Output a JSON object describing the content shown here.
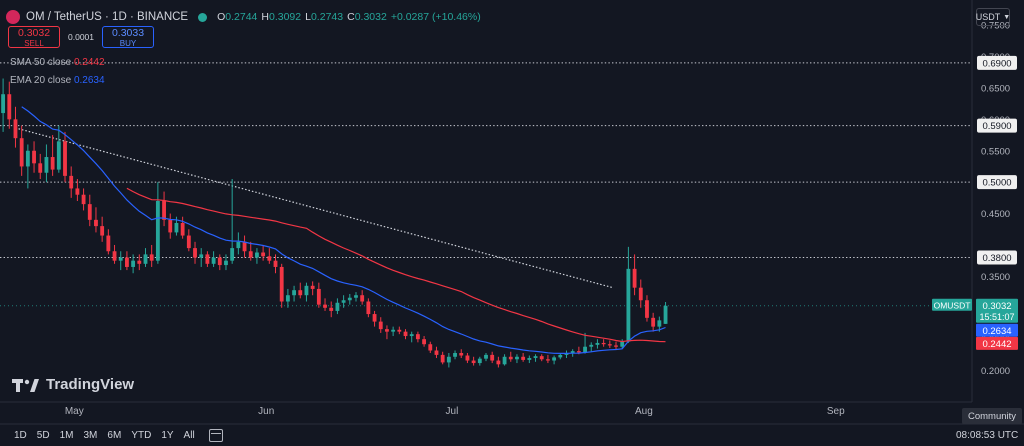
{
  "header": {
    "symbol": "OM / TetherUS · 1D · BINANCE",
    "ohlc": [
      {
        "k": "O",
        "v": "0.2744"
      },
      {
        "k": "H",
        "v": "0.3092"
      },
      {
        "k": "L",
        "v": "0.2743"
      },
      {
        "k": "C",
        "v": "0.3032"
      }
    ],
    "change": "+0.0287 (+10.46%)"
  },
  "trade": {
    "sell_price": "0.3032",
    "sell_label": "SELL",
    "spread": "0.0001",
    "buy_price": "0.3033",
    "buy_label": "BUY"
  },
  "indicators": {
    "sma_label": "SMA 50 close",
    "sma_value": "0.2442",
    "ema_label": "EMA 20 close",
    "ema_value": "0.2634"
  },
  "currency_button": "USDT",
  "branding": "TradingView",
  "timeframes": [
    "1D",
    "5D",
    "1M",
    "3M",
    "6M",
    "YTD",
    "1Y",
    "All"
  ],
  "time_display": "08:08:53 UTC",
  "community_label": "Community",
  "colors": {
    "background": "#131722",
    "up": "#26a69a",
    "down": "#f23645",
    "sma": "#f23645",
    "ema": "#2962ff",
    "text": "#d1d4dc"
  },
  "chart_data": {
    "type": "candlestick",
    "y_axis": {
      "range": [
        0.15,
        0.79
      ],
      "ticks": [
        "0.2000",
        "0.2500",
        "0.3500",
        "0.4500",
        "0.5500",
        "0.6000",
        "0.6500",
        "0.7000",
        "0.7500"
      ]
    },
    "x_axis": {
      "range": [
        "2024-04-19",
        "2024-09-23"
      ],
      "ticks": [
        {
          "label": "May",
          "date": "2024-05-01"
        },
        {
          "label": "Jun",
          "date": "2024-06-01"
        },
        {
          "label": "Jul",
          "date": "2024-07-01"
        },
        {
          "label": "Aug",
          "date": "2024-08-01"
        },
        {
          "label": "Sep",
          "date": "2024-09-01"
        }
      ]
    },
    "grid": false,
    "horizontal_levels": [
      "0.6900",
      "0.5900",
      "0.5000",
      "0.3800"
    ],
    "trendline": {
      "from": [
        "2024-04-22",
        0.585
      ],
      "to": [
        "2024-07-27",
        0.332
      ]
    },
    "last_price": {
      "symbol": "OMUSDT",
      "price": "0.3032",
      "countdown": "15:51:07"
    },
    "candles": [
      {
        "d": "2024-04-19",
        "o": 0.61,
        "h": 0.665,
        "l": 0.58,
        "c": 0.64
      },
      {
        "d": "2024-04-20",
        "o": 0.64,
        "h": 0.66,
        "l": 0.585,
        "c": 0.6
      },
      {
        "d": "2024-04-21",
        "o": 0.6,
        "h": 0.62,
        "l": 0.555,
        "c": 0.57
      },
      {
        "d": "2024-04-22",
        "o": 0.57,
        "h": 0.59,
        "l": 0.51,
        "c": 0.525
      },
      {
        "d": "2024-04-23",
        "o": 0.525,
        "h": 0.56,
        "l": 0.49,
        "c": 0.55
      },
      {
        "d": "2024-04-24",
        "o": 0.55,
        "h": 0.565,
        "l": 0.515,
        "c": 0.53
      },
      {
        "d": "2024-04-25",
        "o": 0.53,
        "h": 0.545,
        "l": 0.505,
        "c": 0.515
      },
      {
        "d": "2024-04-26",
        "o": 0.515,
        "h": 0.56,
        "l": 0.5,
        "c": 0.54
      },
      {
        "d": "2024-04-27",
        "o": 0.54,
        "h": 0.575,
        "l": 0.51,
        "c": 0.52
      },
      {
        "d": "2024-04-28",
        "o": 0.52,
        "h": 0.59,
        "l": 0.515,
        "c": 0.565
      },
      {
        "d": "2024-04-29",
        "o": 0.565,
        "h": 0.58,
        "l": 0.5,
        "c": 0.51
      },
      {
        "d": "2024-04-30",
        "o": 0.51,
        "h": 0.525,
        "l": 0.475,
        "c": 0.49
      },
      {
        "d": "2024-05-01",
        "o": 0.49,
        "h": 0.505,
        "l": 0.47,
        "c": 0.48
      },
      {
        "d": "2024-05-02",
        "o": 0.48,
        "h": 0.49,
        "l": 0.455,
        "c": 0.465
      },
      {
        "d": "2024-05-03",
        "o": 0.465,
        "h": 0.48,
        "l": 0.43,
        "c": 0.44
      },
      {
        "d": "2024-05-04",
        "o": 0.44,
        "h": 0.46,
        "l": 0.42,
        "c": 0.43
      },
      {
        "d": "2024-05-05",
        "o": 0.43,
        "h": 0.445,
        "l": 0.405,
        "c": 0.415
      },
      {
        "d": "2024-05-06",
        "o": 0.415,
        "h": 0.425,
        "l": 0.385,
        "c": 0.39
      },
      {
        "d": "2024-05-07",
        "o": 0.39,
        "h": 0.4,
        "l": 0.37,
        "c": 0.375
      },
      {
        "d": "2024-05-08",
        "o": 0.375,
        "h": 0.39,
        "l": 0.36,
        "c": 0.38
      },
      {
        "d": "2024-05-09",
        "o": 0.38,
        "h": 0.39,
        "l": 0.36,
        "c": 0.365
      },
      {
        "d": "2024-05-10",
        "o": 0.365,
        "h": 0.385,
        "l": 0.355,
        "c": 0.375
      },
      {
        "d": "2024-05-11",
        "o": 0.375,
        "h": 0.385,
        "l": 0.36,
        "c": 0.37
      },
      {
        "d": "2024-05-12",
        "o": 0.37,
        "h": 0.395,
        "l": 0.365,
        "c": 0.385
      },
      {
        "d": "2024-05-13",
        "o": 0.385,
        "h": 0.4,
        "l": 0.365,
        "c": 0.375
      },
      {
        "d": "2024-05-14",
        "o": 0.375,
        "h": 0.5,
        "l": 0.37,
        "c": 0.47
      },
      {
        "d": "2024-05-15",
        "o": 0.47,
        "h": 0.485,
        "l": 0.43,
        "c": 0.44
      },
      {
        "d": "2024-05-16",
        "o": 0.44,
        "h": 0.45,
        "l": 0.41,
        "c": 0.42
      },
      {
        "d": "2024-05-17",
        "o": 0.42,
        "h": 0.445,
        "l": 0.415,
        "c": 0.435
      },
      {
        "d": "2024-05-18",
        "o": 0.435,
        "h": 0.445,
        "l": 0.41,
        "c": 0.415
      },
      {
        "d": "2024-05-19",
        "o": 0.415,
        "h": 0.425,
        "l": 0.39,
        "c": 0.395
      },
      {
        "d": "2024-05-20",
        "o": 0.395,
        "h": 0.405,
        "l": 0.37,
        "c": 0.38
      },
      {
        "d": "2024-05-21",
        "o": 0.38,
        "h": 0.395,
        "l": 0.365,
        "c": 0.385
      },
      {
        "d": "2024-05-22",
        "o": 0.385,
        "h": 0.39,
        "l": 0.365,
        "c": 0.37
      },
      {
        "d": "2024-05-23",
        "o": 0.37,
        "h": 0.39,
        "l": 0.365,
        "c": 0.38
      },
      {
        "d": "2024-05-24",
        "o": 0.38,
        "h": 0.385,
        "l": 0.36,
        "c": 0.368
      },
      {
        "d": "2024-05-25",
        "o": 0.368,
        "h": 0.385,
        "l": 0.36,
        "c": 0.375
      },
      {
        "d": "2024-05-26",
        "o": 0.375,
        "h": 0.505,
        "l": 0.37,
        "c": 0.395
      },
      {
        "d": "2024-05-27",
        "o": 0.395,
        "h": 0.42,
        "l": 0.385,
        "c": 0.405
      },
      {
        "d": "2024-05-28",
        "o": 0.405,
        "h": 0.415,
        "l": 0.38,
        "c": 0.39
      },
      {
        "d": "2024-05-29",
        "o": 0.39,
        "h": 0.405,
        "l": 0.375,
        "c": 0.38
      },
      {
        "d": "2024-05-30",
        "o": 0.38,
        "h": 0.395,
        "l": 0.37,
        "c": 0.388
      },
      {
        "d": "2024-05-31",
        "o": 0.388,
        "h": 0.4,
        "l": 0.375,
        "c": 0.382
      },
      {
        "d": "2024-06-01",
        "o": 0.382,
        "h": 0.395,
        "l": 0.37,
        "c": 0.375
      },
      {
        "d": "2024-06-02",
        "o": 0.375,
        "h": 0.385,
        "l": 0.355,
        "c": 0.365
      },
      {
        "d": "2024-06-03",
        "o": 0.365,
        "h": 0.37,
        "l": 0.3,
        "c": 0.31
      },
      {
        "d": "2024-06-04",
        "o": 0.31,
        "h": 0.33,
        "l": 0.3,
        "c": 0.32
      },
      {
        "d": "2024-06-05",
        "o": 0.32,
        "h": 0.335,
        "l": 0.31,
        "c": 0.328
      },
      {
        "d": "2024-06-06",
        "o": 0.328,
        "h": 0.34,
        "l": 0.315,
        "c": 0.32
      },
      {
        "d": "2024-06-07",
        "o": 0.32,
        "h": 0.34,
        "l": 0.31,
        "c": 0.335
      },
      {
        "d": "2024-06-08",
        "o": 0.335,
        "h": 0.342,
        "l": 0.32,
        "c": 0.33
      },
      {
        "d": "2024-06-09",
        "o": 0.33,
        "h": 0.34,
        "l": 0.3,
        "c": 0.305
      },
      {
        "d": "2024-06-10",
        "o": 0.305,
        "h": 0.315,
        "l": 0.295,
        "c": 0.3
      },
      {
        "d": "2024-06-11",
        "o": 0.3,
        "h": 0.31,
        "l": 0.285,
        "c": 0.295
      },
      {
        "d": "2024-06-12",
        "o": 0.295,
        "h": 0.315,
        "l": 0.29,
        "c": 0.308
      },
      {
        "d": "2024-06-13",
        "o": 0.308,
        "h": 0.32,
        "l": 0.3,
        "c": 0.312
      },
      {
        "d": "2024-06-14",
        "o": 0.312,
        "h": 0.322,
        "l": 0.305,
        "c": 0.316
      },
      {
        "d": "2024-06-15",
        "o": 0.316,
        "h": 0.325,
        "l": 0.31,
        "c": 0.32
      },
      {
        "d": "2024-06-16",
        "o": 0.32,
        "h": 0.328,
        "l": 0.305,
        "c": 0.31
      },
      {
        "d": "2024-06-17",
        "o": 0.31,
        "h": 0.315,
        "l": 0.285,
        "c": 0.29
      },
      {
        "d": "2024-06-18",
        "o": 0.29,
        "h": 0.295,
        "l": 0.27,
        "c": 0.278
      },
      {
        "d": "2024-06-19",
        "o": 0.278,
        "h": 0.285,
        "l": 0.26,
        "c": 0.266
      },
      {
        "d": "2024-06-20",
        "o": 0.266,
        "h": 0.272,
        "l": 0.25,
        "c": 0.262
      },
      {
        "d": "2024-06-21",
        "o": 0.262,
        "h": 0.27,
        "l": 0.255,
        "c": 0.265
      },
      {
        "d": "2024-06-22",
        "o": 0.265,
        "h": 0.27,
        "l": 0.258,
        "c": 0.262
      },
      {
        "d": "2024-06-23",
        "o": 0.262,
        "h": 0.266,
        "l": 0.25,
        "c": 0.255
      },
      {
        "d": "2024-06-24",
        "o": 0.255,
        "h": 0.262,
        "l": 0.245,
        "c": 0.258
      },
      {
        "d": "2024-06-25",
        "o": 0.258,
        "h": 0.262,
        "l": 0.245,
        "c": 0.25
      },
      {
        "d": "2024-06-26",
        "o": 0.25,
        "h": 0.255,
        "l": 0.238,
        "c": 0.242
      },
      {
        "d": "2024-06-27",
        "o": 0.242,
        "h": 0.246,
        "l": 0.228,
        "c": 0.232
      },
      {
        "d": "2024-06-28",
        "o": 0.232,
        "h": 0.238,
        "l": 0.22,
        "c": 0.225
      },
      {
        "d": "2024-06-29",
        "o": 0.225,
        "h": 0.23,
        "l": 0.21,
        "c": 0.213
      },
      {
        "d": "2024-06-30",
        "o": 0.213,
        "h": 0.228,
        "l": 0.205,
        "c": 0.222
      },
      {
        "d": "2024-07-01",
        "o": 0.222,
        "h": 0.232,
        "l": 0.218,
        "c": 0.228
      },
      {
        "d": "2024-07-02",
        "o": 0.228,
        "h": 0.234,
        "l": 0.22,
        "c": 0.224
      },
      {
        "d": "2024-07-03",
        "o": 0.224,
        "h": 0.228,
        "l": 0.212,
        "c": 0.216
      },
      {
        "d": "2024-07-04",
        "o": 0.216,
        "h": 0.222,
        "l": 0.208,
        "c": 0.212
      },
      {
        "d": "2024-07-05",
        "o": 0.212,
        "h": 0.222,
        "l": 0.208,
        "c": 0.219
      },
      {
        "d": "2024-07-06",
        "o": 0.219,
        "h": 0.228,
        "l": 0.215,
        "c": 0.225
      },
      {
        "d": "2024-07-07",
        "o": 0.225,
        "h": 0.23,
        "l": 0.212,
        "c": 0.216
      },
      {
        "d": "2024-07-08",
        "o": 0.216,
        "h": 0.222,
        "l": 0.205,
        "c": 0.21
      },
      {
        "d": "2024-07-09",
        "o": 0.21,
        "h": 0.226,
        "l": 0.208,
        "c": 0.222
      },
      {
        "d": "2024-07-10",
        "o": 0.222,
        "h": 0.23,
        "l": 0.214,
        "c": 0.218
      },
      {
        "d": "2024-07-11",
        "o": 0.218,
        "h": 0.226,
        "l": 0.212,
        "c": 0.222
      },
      {
        "d": "2024-07-12",
        "o": 0.222,
        "h": 0.228,
        "l": 0.214,
        "c": 0.217
      },
      {
        "d": "2024-07-13",
        "o": 0.217,
        "h": 0.224,
        "l": 0.212,
        "c": 0.22
      },
      {
        "d": "2024-07-14",
        "o": 0.22,
        "h": 0.226,
        "l": 0.214,
        "c": 0.223
      },
      {
        "d": "2024-07-15",
        "o": 0.223,
        "h": 0.226,
        "l": 0.215,
        "c": 0.218
      },
      {
        "d": "2024-07-16",
        "o": 0.218,
        "h": 0.225,
        "l": 0.212,
        "c": 0.216
      },
      {
        "d": "2024-07-17",
        "o": 0.216,
        "h": 0.224,
        "l": 0.21,
        "c": 0.221
      },
      {
        "d": "2024-07-18",
        "o": 0.221,
        "h": 0.228,
        "l": 0.218,
        "c": 0.225
      },
      {
        "d": "2024-07-19",
        "o": 0.225,
        "h": 0.232,
        "l": 0.22,
        "c": 0.228
      },
      {
        "d": "2024-07-20",
        "o": 0.228,
        "h": 0.234,
        "l": 0.222,
        "c": 0.231
      },
      {
        "d": "2024-07-21",
        "o": 0.231,
        "h": 0.238,
        "l": 0.226,
        "c": 0.229
      },
      {
        "d": "2024-07-22",
        "o": 0.229,
        "h": 0.26,
        "l": 0.227,
        "c": 0.238
      },
      {
        "d": "2024-07-23",
        "o": 0.238,
        "h": 0.245,
        "l": 0.23,
        "c": 0.241
      },
      {
        "d": "2024-07-24",
        "o": 0.241,
        "h": 0.25,
        "l": 0.235,
        "c": 0.244
      },
      {
        "d": "2024-07-25",
        "o": 0.244,
        "h": 0.25,
        "l": 0.238,
        "c": 0.242
      },
      {
        "d": "2024-07-26",
        "o": 0.242,
        "h": 0.248,
        "l": 0.236,
        "c": 0.24
      },
      {
        "d": "2024-07-27",
        "o": 0.24,
        "h": 0.246,
        "l": 0.234,
        "c": 0.238
      },
      {
        "d": "2024-07-28",
        "o": 0.238,
        "h": 0.25,
        "l": 0.235,
        "c": 0.246
      },
      {
        "d": "2024-07-29",
        "o": 0.246,
        "h": 0.397,
        "l": 0.244,
        "c": 0.362
      },
      {
        "d": "2024-07-30",
        "o": 0.362,
        "h": 0.385,
        "l": 0.32,
        "c": 0.332
      },
      {
        "d": "2024-07-31",
        "o": 0.332,
        "h": 0.345,
        "l": 0.3,
        "c": 0.312
      },
      {
        "d": "2024-08-01",
        "o": 0.312,
        "h": 0.32,
        "l": 0.278,
        "c": 0.284
      },
      {
        "d": "2024-08-02",
        "o": 0.284,
        "h": 0.292,
        "l": 0.262,
        "c": 0.27
      },
      {
        "d": "2024-08-03",
        "o": 0.27,
        "h": 0.286,
        "l": 0.262,
        "c": 0.28
      },
      {
        "d": "2024-08-04",
        "o": 0.2744,
        "h": 0.3092,
        "l": 0.2743,
        "c": 0.3032
      }
    ]
  }
}
